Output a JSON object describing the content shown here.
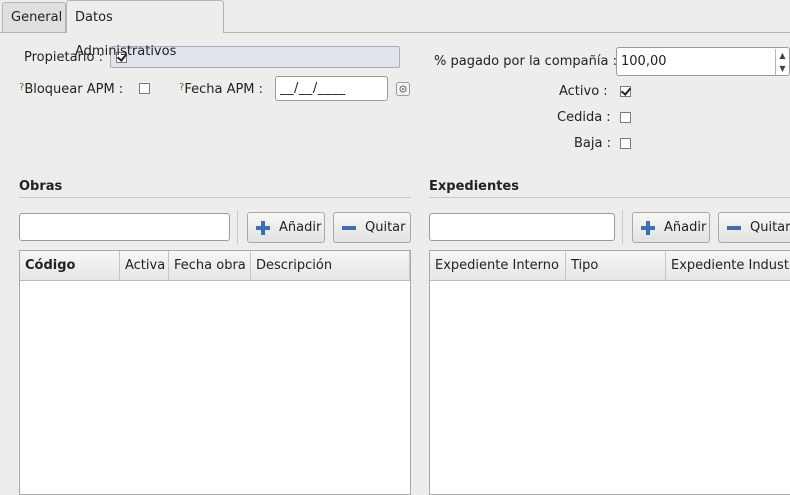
{
  "tabs": [
    {
      "label": "General"
    },
    {
      "label": "Datos Administrativos"
    }
  ],
  "form": {
    "propietario_label": "Propietario :",
    "bloquear_label": "Bloquear APM :",
    "fecha_label": "Fecha APM :",
    "fecha_value": "__/__/____",
    "help_mark": "?",
    "pagado_label": "% pagado por la compañía :",
    "pagado_value": "100,00",
    "activo_label": "Activo :",
    "cedida_label": "Cedida :",
    "baja_label": "Baja :"
  },
  "checks": {
    "propietario": true,
    "bloquear": false,
    "activo": true,
    "cedida": false,
    "baja": false
  },
  "obras": {
    "title": "Obras",
    "search_value": "",
    "add_label": "Añadir",
    "remove_label": "Quitar",
    "columns": [
      "Código",
      "Activa",
      "Fecha obra",
      "Descripción"
    ]
  },
  "expedientes": {
    "title": "Expedientes",
    "search_value": "",
    "add_label": "Añadir",
    "remove_label": "Quitar",
    "columns": [
      "Expediente Interno",
      "Tipo",
      "Expediente Industria"
    ]
  },
  "icons": {
    "add": "plus-icon",
    "remove": "minus-icon",
    "calendar": "calendar-icon",
    "spin": "spin-arrows-icon"
  }
}
